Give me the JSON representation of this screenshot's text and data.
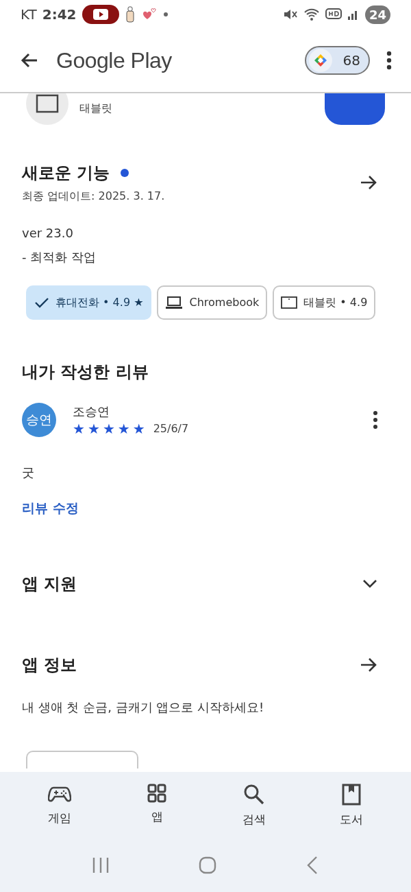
{
  "status_bar": {
    "carrier": "KT",
    "time": "2:42",
    "battery": "24"
  },
  "app_bar": {
    "title": "Google Play",
    "points": "68"
  },
  "partial_item": {
    "subtitle": "태블릿"
  },
  "whats_new": {
    "title": "새로운 기능",
    "updated": "최종 업데이트: 2025. 3. 17.",
    "notes": [
      "ver 23.0",
      "- 최적화 작업"
    ]
  },
  "device_chips": [
    {
      "kind": "phone",
      "label": "휴대전화 • 4.9 ★",
      "selected": true
    },
    {
      "kind": "laptop",
      "label": "Chromebook",
      "selected": false
    },
    {
      "kind": "tablet",
      "label": "태블릿 • 4.9",
      "selected": false
    }
  ],
  "my_review": {
    "heading": "내가 작성한 리뷰",
    "avatar_text": "승연",
    "author": "조승연",
    "stars": 5,
    "date": "25/6/7",
    "body": "굿",
    "edit_link": "리뷰 수정"
  },
  "sections": [
    {
      "kind": "expand",
      "title": "앱 지원"
    },
    {
      "kind": "arrow",
      "title": "앱 정보",
      "description": "내 생애 첫 순금, 금캐기 앱으로 시작하세요!"
    }
  ],
  "nav_tabs": [
    {
      "kind": "games",
      "label": "게임"
    },
    {
      "kind": "apps",
      "label": "앱"
    },
    {
      "kind": "search",
      "label": "검색"
    },
    {
      "kind": "books",
      "label": "도서"
    }
  ]
}
